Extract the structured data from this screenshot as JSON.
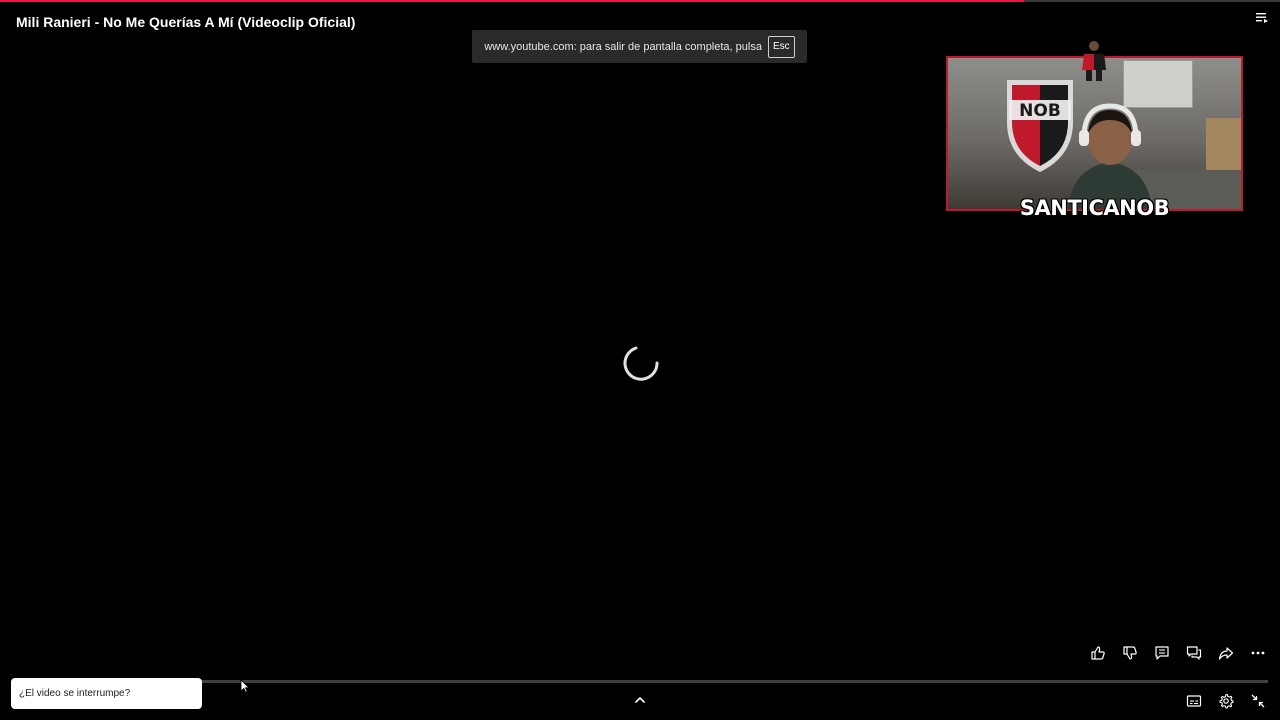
{
  "video": {
    "title": "Mili Ranieri - No Me Querías A Mí (Videoclip Oficial)",
    "progress_fraction": 0.8
  },
  "fullscreen_toast": {
    "message": "www.youtube.com: para salir de pantalla completa, pulsa",
    "key": "Esc"
  },
  "webcam": {
    "streamer_name": "SANTICANOB",
    "shield_text": "NOB",
    "border_color": "#c0192c"
  },
  "help_chip": {
    "text": "¿El video se interrumpe?"
  },
  "actions": [
    {
      "icon": "thumbs-up-icon"
    },
    {
      "icon": "thumbs-down-icon"
    },
    {
      "icon": "comments-icon"
    },
    {
      "icon": "live-chat-icon"
    },
    {
      "icon": "share-icon"
    },
    {
      "icon": "more-icon"
    }
  ],
  "controls": [
    {
      "icon": "subtitles-icon"
    },
    {
      "icon": "settings-gear-icon"
    },
    {
      "icon": "exit-fullscreen-icon"
    }
  ],
  "colors": {
    "accent": "#e8174a",
    "background": "#000000",
    "toast_bg": "#2a2a2a"
  }
}
